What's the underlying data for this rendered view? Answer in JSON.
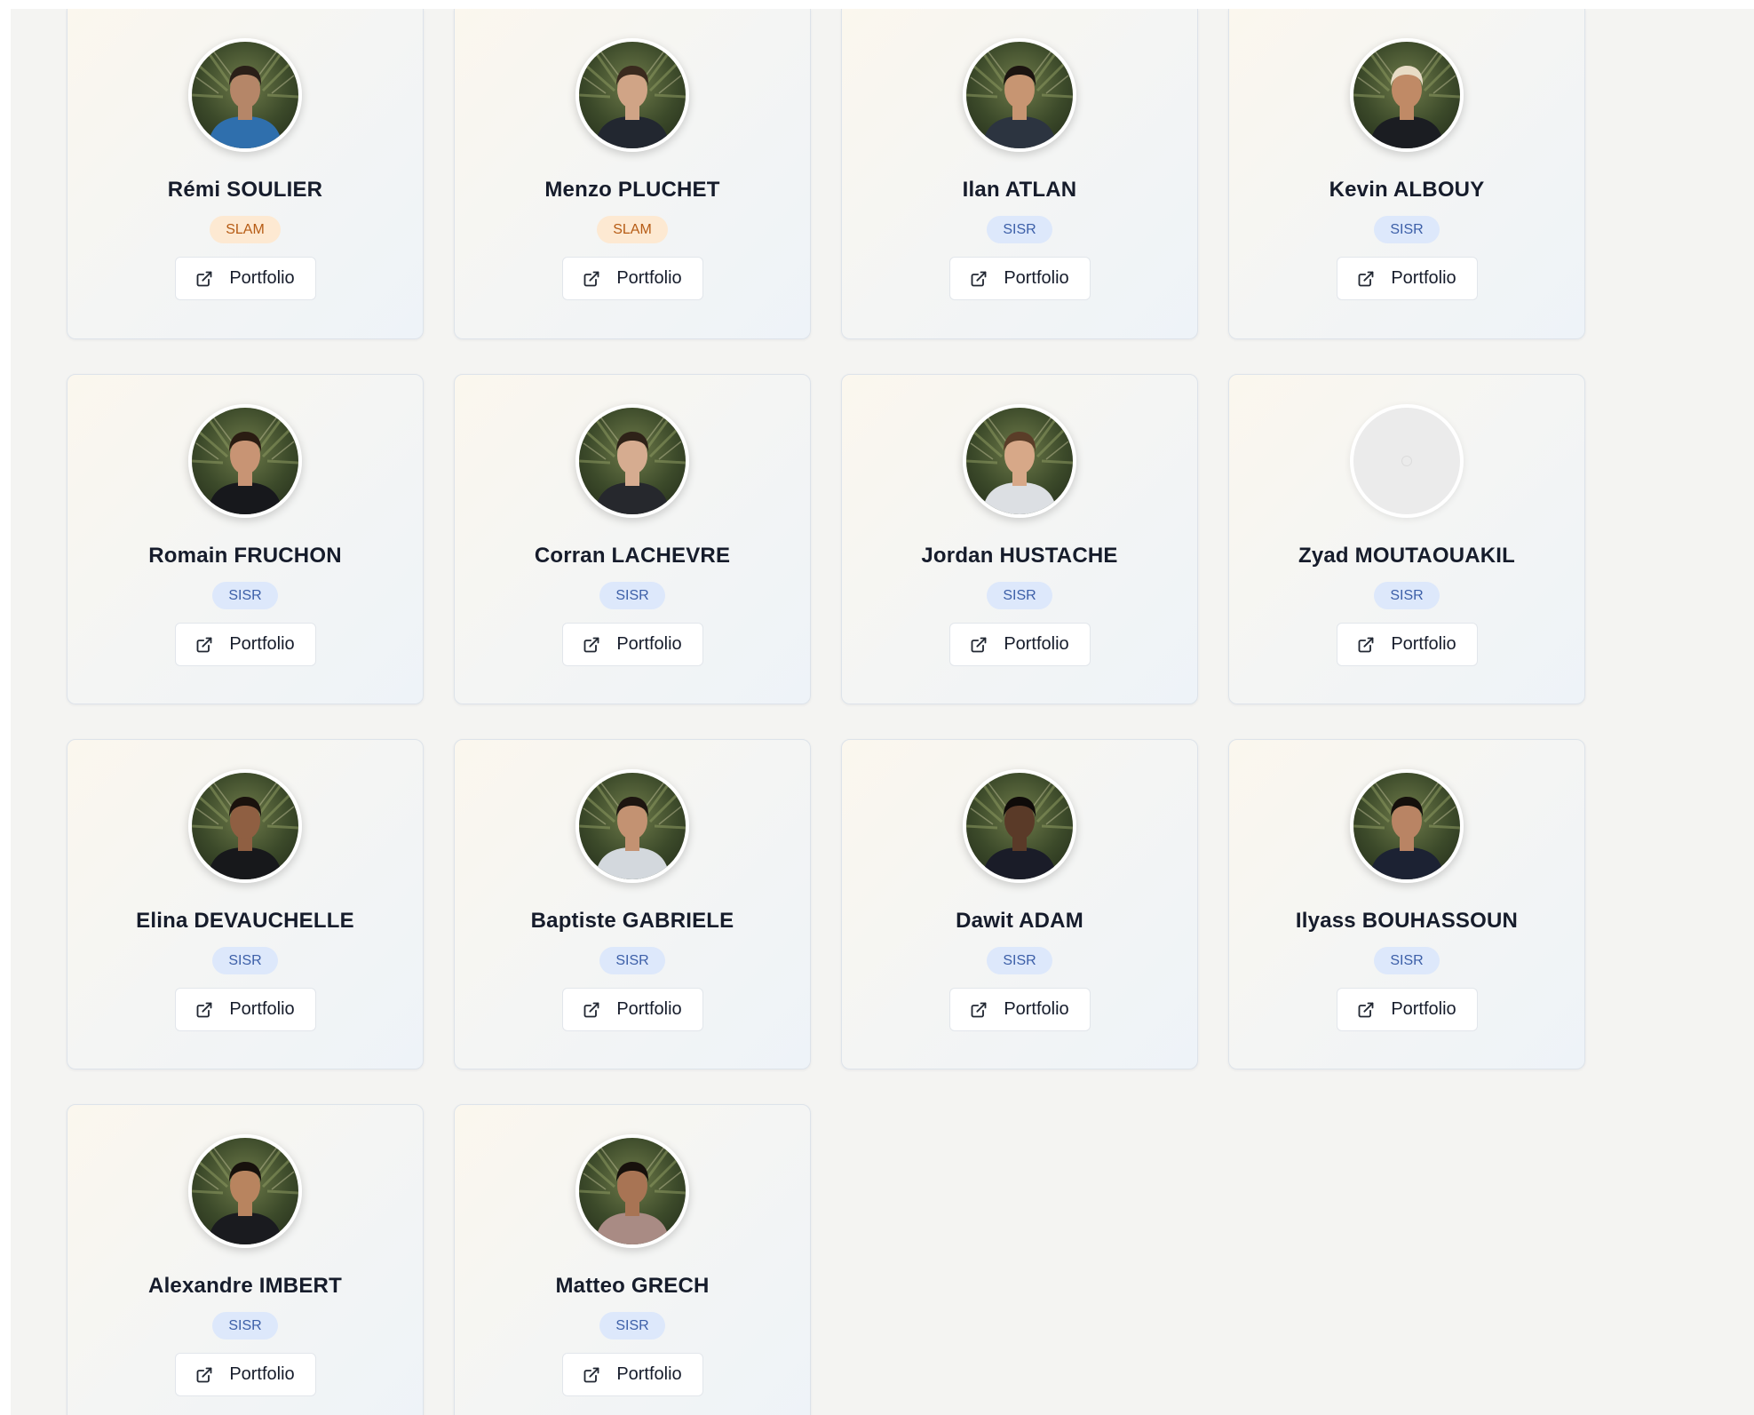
{
  "students": [
    {
      "name": "Rémi SOULIER",
      "track": "SLAM",
      "button": "Portfolio",
      "photo": true,
      "shirt": "#2f6fad",
      "skin": "#b58668",
      "hair": "#2a1f18"
    },
    {
      "name": "Menzo PLUCHET",
      "track": "SLAM",
      "button": "Portfolio",
      "photo": true,
      "shirt": "#222730",
      "skin": "#d0a486",
      "hair": "#3a2a1e"
    },
    {
      "name": "Ilan ATLAN",
      "track": "SISR",
      "button": "Portfolio",
      "photo": true,
      "shirt": "#2c3440",
      "skin": "#c79572",
      "hair": "#1c1410"
    },
    {
      "name": "Kevin ALBOUY",
      "track": "SISR",
      "button": "Portfolio",
      "photo": true,
      "shirt": "#1b1d22",
      "skin": "#c08a66",
      "hair": "#e8dcc6"
    },
    {
      "name": "Romain FRUCHON",
      "track": "SISR",
      "button": "Portfolio",
      "photo": true,
      "shirt": "#17181c",
      "skin": "#c89474",
      "hair": "#2a1c12"
    },
    {
      "name": "Corran LACHEVRE",
      "track": "SISR",
      "button": "Portfolio",
      "photo": true,
      "shirt": "#26282d",
      "skin": "#d6ac90",
      "hair": "#2e2218"
    },
    {
      "name": "Jordan HUSTACHE",
      "track": "SISR",
      "button": "Portfolio",
      "photo": true,
      "shirt": "#dcdfe3",
      "skin": "#d7a888",
      "hair": "#5a3d28"
    },
    {
      "name": "Zyad MOUTAOUAKIL",
      "track": "SISR",
      "button": "Portfolio",
      "photo": false
    },
    {
      "name": "Elina DEVAUCHELLE",
      "track": "SISR",
      "button": "Portfolio",
      "photo": true,
      "shirt": "#17181b",
      "skin": "#8f5f42",
      "hair": "#1a120d"
    },
    {
      "name": "Baptiste GABRIELE",
      "track": "SISR",
      "button": "Portfolio",
      "photo": true,
      "shirt": "#d3d8dd",
      "skin": "#c39272",
      "hair": "#1d1510"
    },
    {
      "name": "Dawit ADAM",
      "track": "SISR",
      "button": "Portfolio",
      "photo": true,
      "shirt": "#1a1c28",
      "skin": "#5a3a28",
      "hair": "#0f0b09"
    },
    {
      "name": "Ilyass BOUHASSOUN",
      "track": "SISR",
      "button": "Portfolio",
      "photo": true,
      "shirt": "#1c2233",
      "skin": "#b98464",
      "hair": "#15100c"
    },
    {
      "name": "Alexandre IMBERT",
      "track": "SISR",
      "button": "Portfolio",
      "photo": true,
      "shirt": "#1a1b1f",
      "skin": "#b8845f",
      "hair": "#17110c"
    },
    {
      "name": "Matteo GRECH",
      "track": "SISR",
      "button": "Portfolio",
      "photo": true,
      "shirt": "#a98b84",
      "skin": "#a87454",
      "hair": "#17110c"
    }
  ]
}
